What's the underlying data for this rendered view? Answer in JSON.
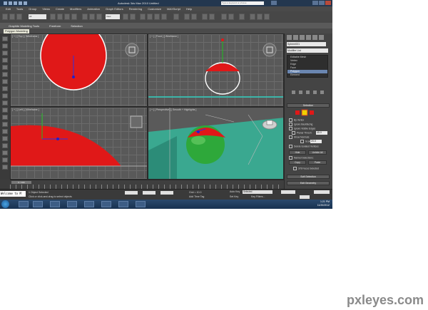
{
  "titlebar": {
    "title": "Autodesk 3ds Max 2010     Untitled",
    "search_placeholder": "Type a keyword or phrase"
  },
  "menu": [
    "Edit",
    "Tools",
    "Group",
    "Views",
    "Create",
    "Modifiers",
    "Animation",
    "Graph Editors",
    "Rendering",
    "Customize",
    "MAXScript",
    "Help"
  ],
  "toolbar": {
    "selection_filter": "All",
    "view_combo": "View"
  },
  "ribbon": {
    "tabs": [
      "Graphite Modeling Tools",
      "Freeform",
      "Selection"
    ],
    "active_panel": "Polygon Modeling"
  },
  "viewports": {
    "top_label": "[ + ] [ Top ] [ Wireframe ]",
    "front_label": "[ + ] [ Front ] [ Wireframe ]",
    "left_label": "[ + ] [ Left ] [ Wireframe ]",
    "perspective_label": "[ + ] [ Perspective ] [ Smooth + Highlights ]"
  },
  "command_panel": {
    "object_name": "Sphere001",
    "modifier_list_label": "Modifier List",
    "modifier_stack": [
      {
        "label": "Editable Mesh",
        "selected": false
      },
      {
        "label": "Vertex",
        "selected": false
      },
      {
        "label": "Edge",
        "selected": false
      },
      {
        "label": "Face",
        "selected": false
      },
      {
        "label": "Polygon",
        "selected": true
      },
      {
        "label": "Element",
        "selected": false
      }
    ],
    "selection_rollout": "Selection",
    "options": [
      "By Vertex",
      "Ignore Backfacing",
      "Ignore Visible Edges"
    ],
    "planar_thresh_label": "Planar Thresh:",
    "planar_thresh_value": "45.0",
    "show_normals": "Show Normals",
    "scale_label": "Scale:",
    "scale_value": "20.0",
    "delete_isolated": "Delete Isolated Vertices",
    "hide_button": "Hide",
    "unhide_all_button": "Unhide All",
    "named_selections": "Named Selections:",
    "copy_button": "Copy",
    "paste_button": "Paste",
    "selected_count": "378 Faces Selected",
    "soft_selection": "Soft Selection",
    "edit_geometry": "Edit Geometry"
  },
  "timeline": {
    "frame_display": "0 / 100"
  },
  "status": {
    "maxscript_prompt": "Welcome to M",
    "objects_selected": "1 Object Selected",
    "hint": "Click or click-and-drag to select objects",
    "grid": "Grid = 10.0",
    "add_time_tag": "Add Time Tag",
    "autokey": "Auto Key",
    "setkey": "Set Key",
    "selected_dropdown": "Selected",
    "key_filters": "Key Filters..."
  },
  "taskbar": {
    "time": "1:21 PM",
    "date": "11/20/2012"
  },
  "watermark": "pxleyes.com"
}
